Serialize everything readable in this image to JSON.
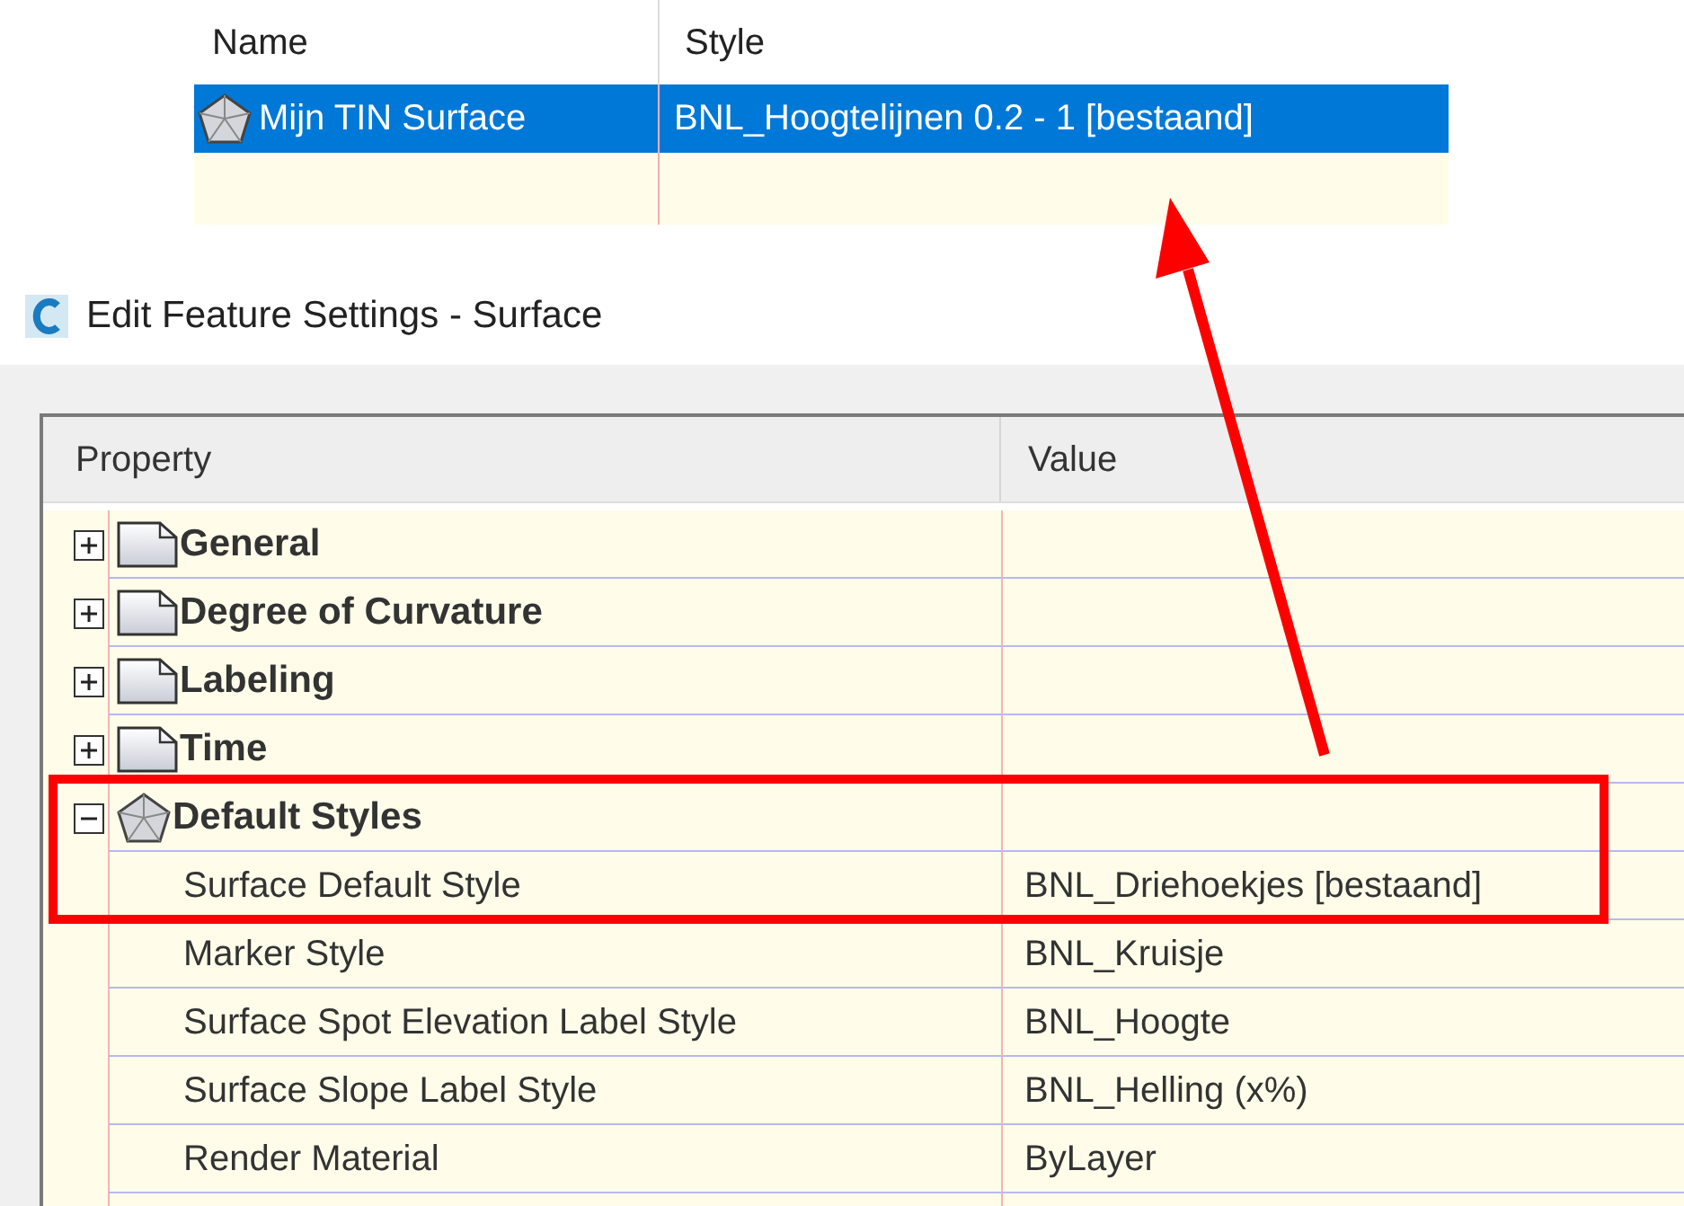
{
  "surface_list": {
    "columns": [
      "Name",
      "Style"
    ],
    "rows": [
      {
        "name": "Mijn TIN Surface",
        "style": "BNL_Hoogtelijnen 0.2 - 1 [bestaand]",
        "selected": true
      }
    ]
  },
  "dialog": {
    "title": "Edit Feature Settings - Surface"
  },
  "property_grid": {
    "columns": [
      "Property",
      "Value"
    ],
    "categories": [
      {
        "label": "General",
        "kind": "page",
        "expanded": false
      },
      {
        "label": "Degree of Curvature",
        "kind": "page",
        "expanded": false
      },
      {
        "label": "Labeling",
        "kind": "page",
        "expanded": false
      },
      {
        "label": "Time",
        "kind": "page",
        "expanded": false
      },
      {
        "label": "Default Styles",
        "kind": "surface",
        "expanded": true,
        "children": [
          {
            "property": "Surface Default Style",
            "value": "BNL_Driehoekjes [bestaand]"
          },
          {
            "property": "Marker Style",
            "value": "BNL_Kruisje"
          },
          {
            "property": "Surface Spot Elevation Label Style",
            "value": "BNL_Hoogte"
          },
          {
            "property": "Surface Slope Label Style",
            "value": "BNL_Helling (x%)"
          },
          {
            "property": "Render Material",
            "value": "ByLayer"
          }
        ]
      }
    ]
  }
}
